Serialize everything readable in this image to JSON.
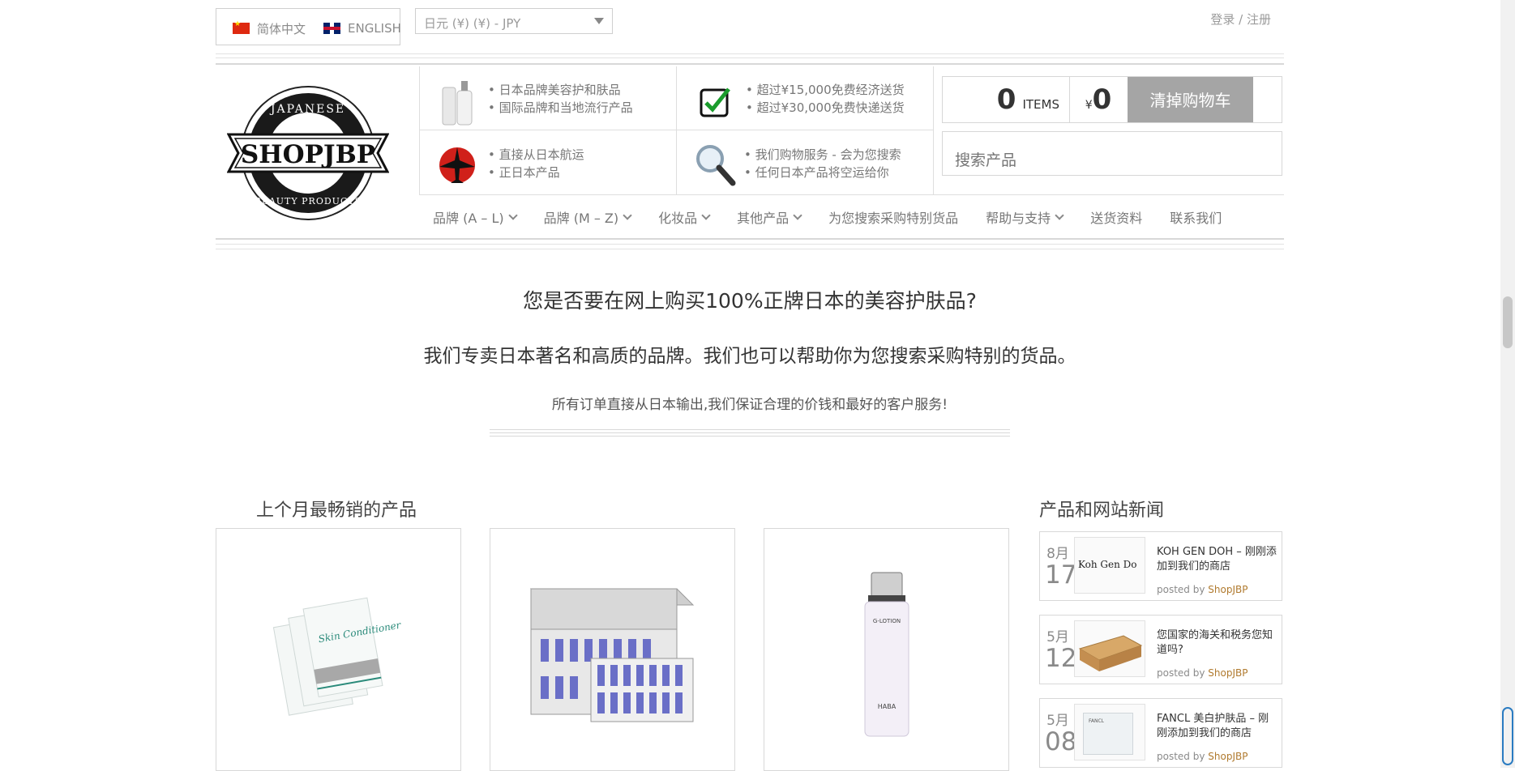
{
  "header": {
    "lang_cn": "简体中文",
    "lang_en": "ENGLISH",
    "currency": "日元 (¥) (¥) - JPY",
    "login": "登录",
    "sep": "/",
    "register": "注册"
  },
  "features": [
    {
      "line1": "• 日本品牌美容护和肤品",
      "line2": "• 国际品牌和当地流行产品"
    },
    {
      "line1": "• 超过¥15,000免费经济送货",
      "line2": "• 超过¥30,000免费快递送货"
    },
    {
      "line1": "• 直接从日本航运",
      "line2": "• 正日本产品"
    },
    {
      "line1": "• 我们购物服务 - 会为您搜索",
      "line2": "• 任何日本产品将空运给你"
    }
  ],
  "logo": {
    "top": "JAPANESE",
    "name": "SHOPJBP",
    "bottom": "BEAUTY PRODUCTS"
  },
  "cart": {
    "count": "0",
    "items_label": "ITEMS",
    "yen": "¥",
    "total": "0",
    "clear_label": "清掉购物车"
  },
  "search": {
    "placeholder": "搜索产品"
  },
  "nav": [
    {
      "label": "品牌 (A – L)",
      "dropdown": true
    },
    {
      "label": "品牌 (M – Z)",
      "dropdown": true
    },
    {
      "label": "化妆品",
      "dropdown": true
    },
    {
      "label": "其他产品",
      "dropdown": true
    },
    {
      "label": "为您搜索采购特别货品",
      "dropdown": false
    },
    {
      "label": "帮助与支持",
      "dropdown": true
    },
    {
      "label": "送货资料",
      "dropdown": false
    },
    {
      "label": "联系我们",
      "dropdown": false
    }
  ],
  "hero": {
    "line1": "您是否要在网上购买100%正牌日本的美容护肤品?",
    "line2": "我们专卖日本著名和高质的品牌。我们也可以帮助你为您搜索采购特别的货品。",
    "line3": "所有订单直接从日本输出,我们保证合理的价钱和最好的客户服务!"
  },
  "bestsellers": {
    "title": "上个月最畅销的产品"
  },
  "news": {
    "title": "产品和网站新闻",
    "items": [
      {
        "month": "8月",
        "day": "17",
        "title": "KOH GEN DOH – 刚刚添加到我们的商店",
        "posted": "posted by",
        "author": "ShopJBP",
        "thumb_text": "Koh Gen Do"
      },
      {
        "month": "5月",
        "day": "12",
        "title": "您国家的海关和税务您知道吗?",
        "posted": "posted by",
        "author": "ShopJBP"
      },
      {
        "month": "5月",
        "day": "08",
        "title": "FANCL 美白护肤品 – 刚刚添加到我们的商店",
        "posted": "posted by",
        "author": "ShopJBP",
        "thumb_text": "FANCL"
      }
    ]
  },
  "product_labels": {
    "p1": "Skin Conditioner",
    "p3_top": "G-LOTION",
    "p3_brand": "HABA"
  }
}
